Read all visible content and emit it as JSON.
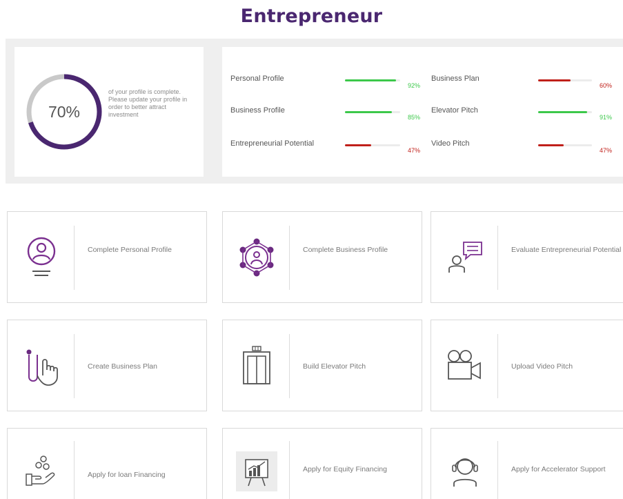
{
  "page": {
    "title": "Entrepreneur"
  },
  "completion": {
    "percent_label": "70%",
    "percent": 70,
    "message": "of your profile is complete. Please update your profile in order to better attract investment",
    "colors": {
      "progress": "#4a2770",
      "remainder": "#c9c9c9"
    }
  },
  "metrics": [
    {
      "label": "Personal Profile",
      "value_label": "92%",
      "value": 92,
      "color": "#3cc84a"
    },
    {
      "label": "Business Profile",
      "value_label": "85%",
      "value": 85,
      "color": "#3cc84a"
    },
    {
      "label": "Entrepreneurial Potential",
      "value_label": "47%",
      "value": 47,
      "color": "#c0201a"
    },
    {
      "label": "Business Plan",
      "value_label": "60%",
      "value": 60,
      "color": "#c0201a"
    },
    {
      "label": "Elevator Pitch",
      "value_label": "91%",
      "value": 91,
      "color": "#3cc84a"
    },
    {
      "label": "Video Pitch",
      "value_label": "47%",
      "value": 47,
      "color": "#c0201a"
    }
  ],
  "actions": [
    {
      "label": "Complete Personal Profile",
      "icon": "user-circle-icon"
    },
    {
      "label": "Complete Business Profile",
      "icon": "network-icon"
    },
    {
      "label": "Evaluate Entrepreneurial Potential",
      "icon": "person-chat-icon"
    },
    {
      "label": "Create Business Plan",
      "icon": "hand-pointer-icon"
    },
    {
      "label": "Build Elevator Pitch",
      "icon": "elevator-icon"
    },
    {
      "label": "Upload Video Pitch",
      "icon": "video-camera-icon"
    },
    {
      "label": "Apply for loan Financing",
      "icon": "hand-coins-icon"
    },
    {
      "label": "Apply for Equity Financing",
      "icon": "chart-board-icon"
    },
    {
      "label": "Apply for Accelerator Support",
      "icon": "headset-person-icon"
    }
  ],
  "colors": {
    "accent": "#4a2770",
    "icon_purple": "#7a2f8f",
    "icon_gray": "#7a7a7a"
  }
}
